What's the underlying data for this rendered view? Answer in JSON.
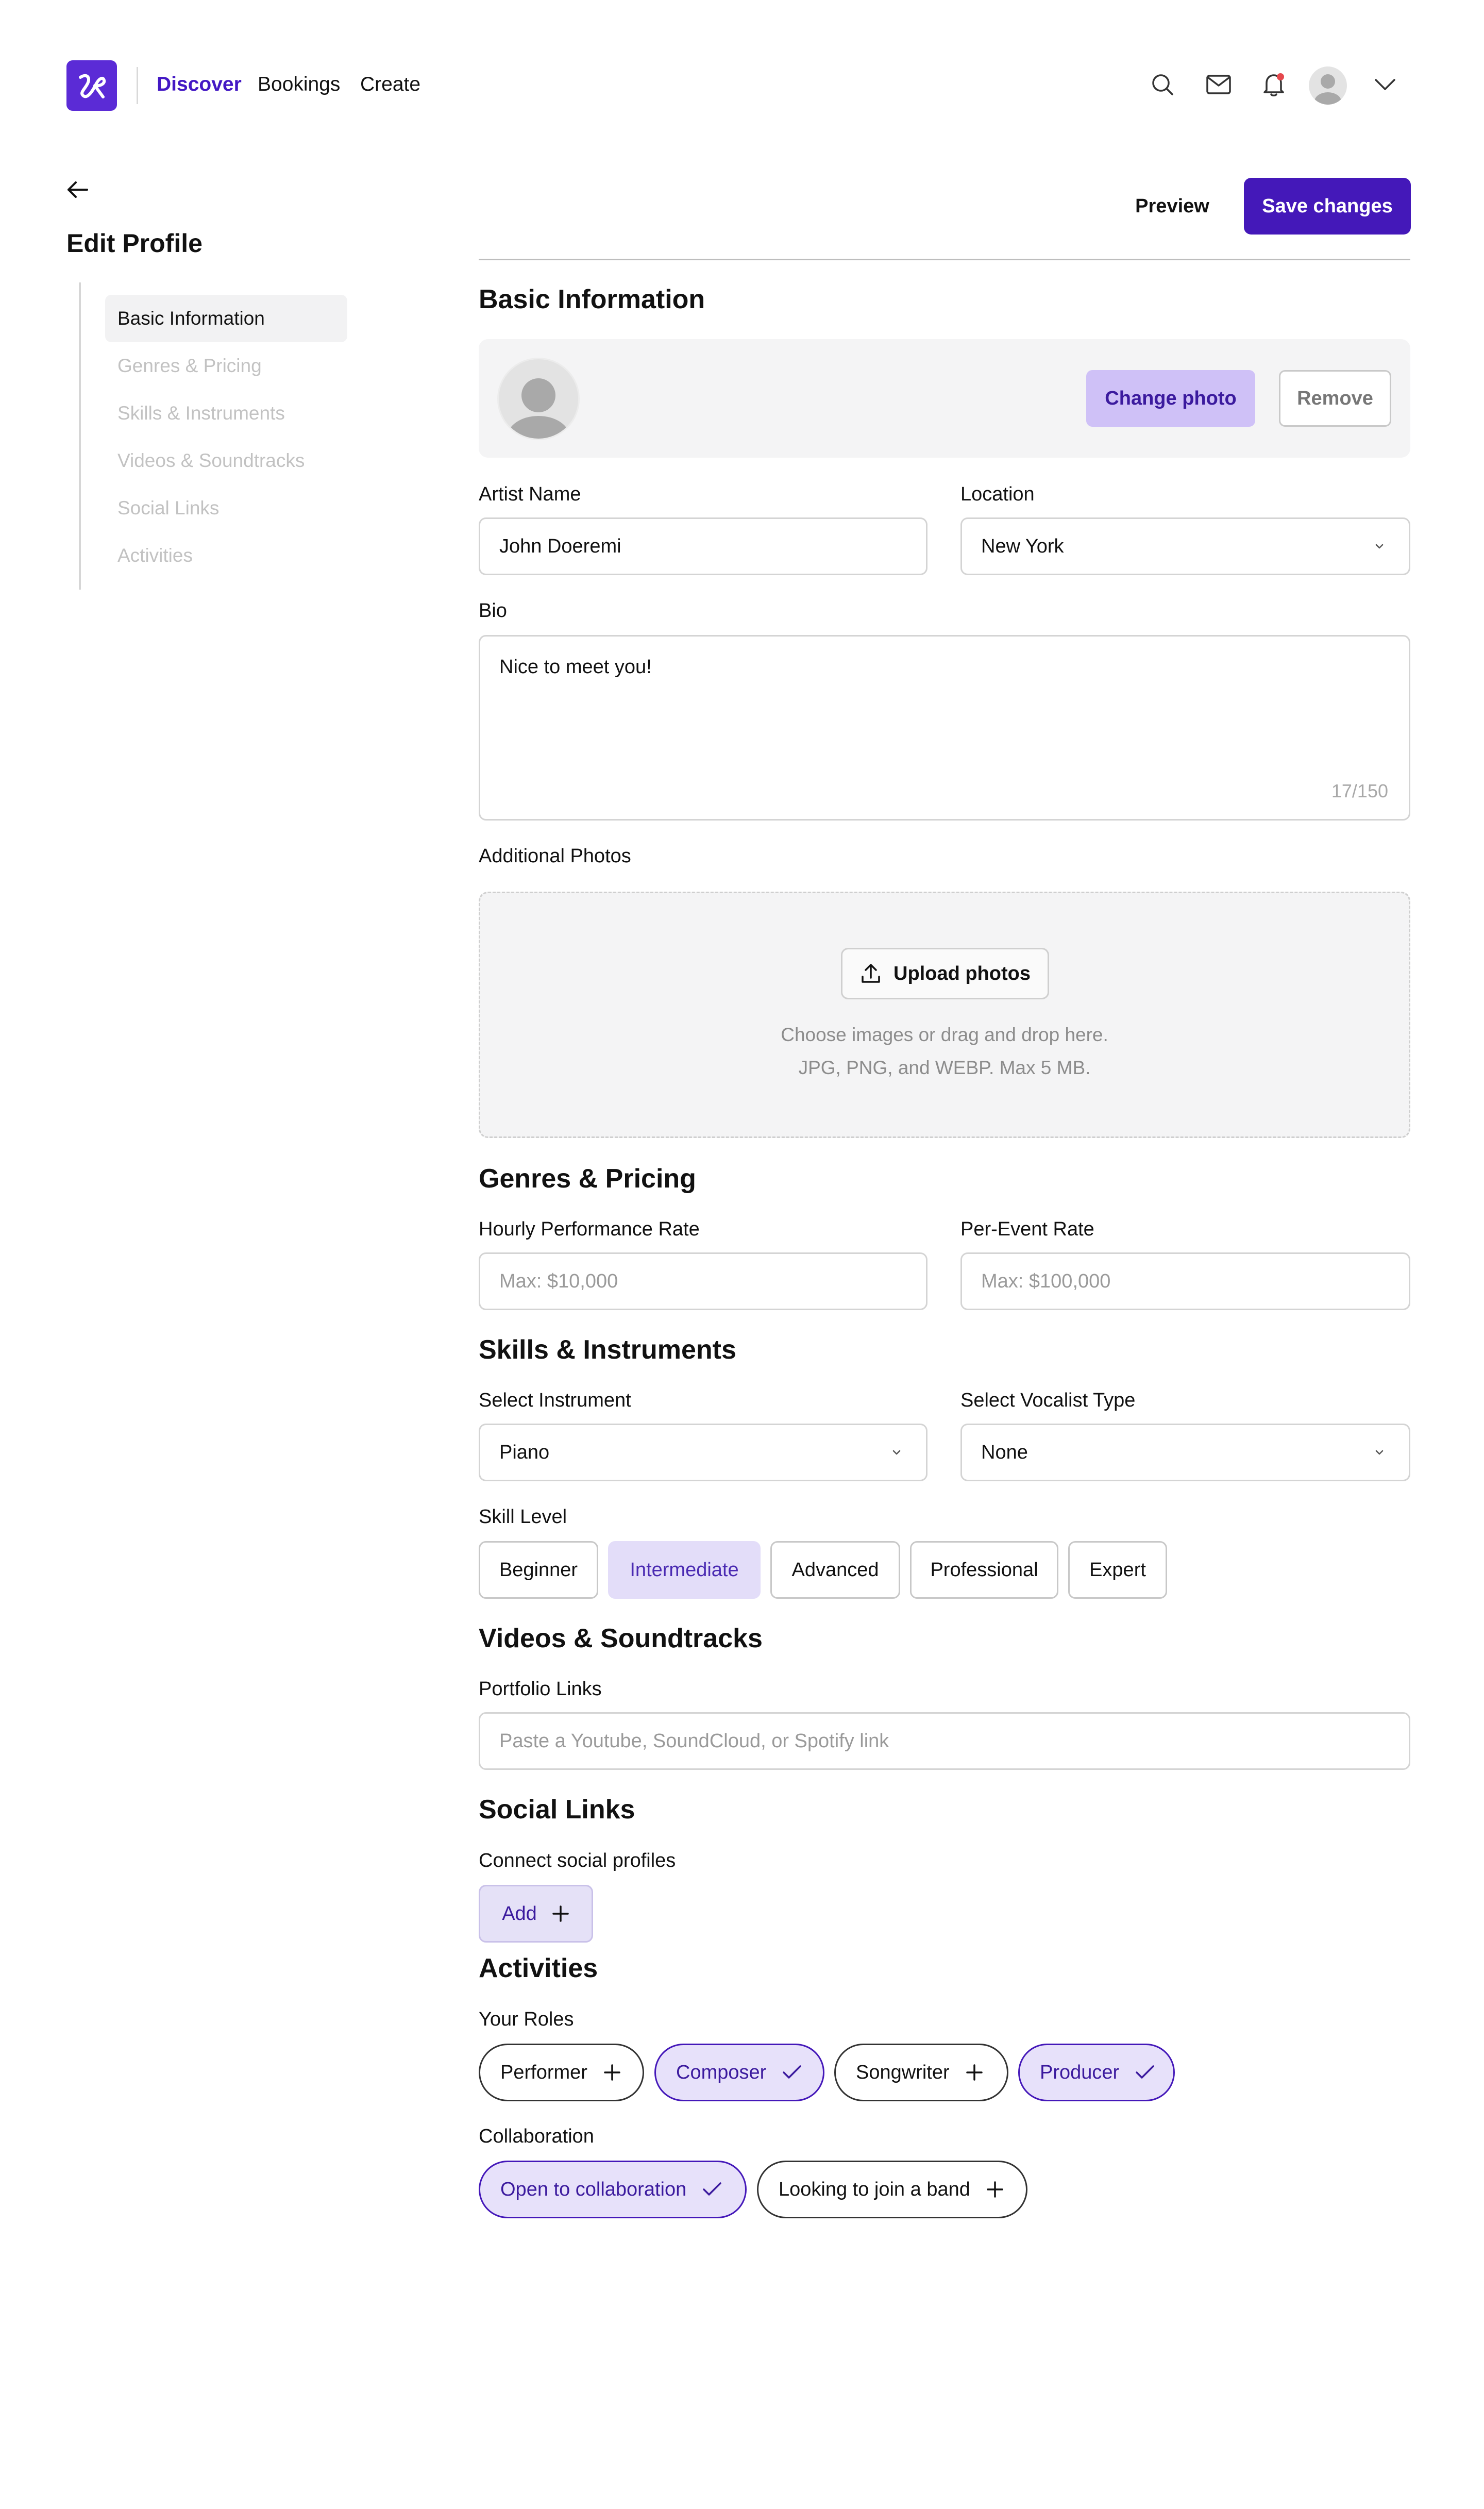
{
  "nav": {
    "links": [
      "Discover",
      "Bookings",
      "Create"
    ],
    "active": "Discover",
    "icons": [
      "search-icon",
      "mail-icon",
      "bell-icon",
      "avatar",
      "chevron-down-icon"
    ],
    "accent": "#4318c4",
    "notification_dot_color": "#e5484d"
  },
  "sidebar": {
    "title": "Edit Profile",
    "items": [
      {
        "label": "Basic Information",
        "active": true
      },
      {
        "label": "Genres & Pricing"
      },
      {
        "label": "Skills & Instruments"
      },
      {
        "label": "Videos & Soundtracks"
      },
      {
        "label": "Social Links"
      },
      {
        "label": "Activities"
      }
    ]
  },
  "actions": {
    "preview": "Preview",
    "save": "Save changes",
    "save_color": "#4418b9"
  },
  "basic": {
    "title": "Basic Information",
    "change_photo": "Change photo",
    "remove": "Remove",
    "artist_name_label": "Artist Name",
    "artist_name_value": "John Doeremi",
    "location_label": "Location",
    "location_value": "New York",
    "bio_label": "Bio",
    "bio_value": "Nice to meet you!",
    "bio_count": "17/150",
    "photos_label": "Additional Photos",
    "upload": "Upload photos",
    "hint_1": "Choose images or drag and drop here.",
    "hint_2": "JPG, PNG, and WEBP. Max 5 MB."
  },
  "pricing": {
    "title": "Genres & Pricing",
    "hourly_label": "Hourly Performance Rate",
    "hourly_placeholder": "Max: $10,000",
    "event_label": "Per-Event Rate",
    "event_placeholder": "Max: $100,000"
  },
  "skills": {
    "title": "Skills & Instruments",
    "instrument_label": "Select Instrument",
    "instrument_value": "Piano",
    "vocalist_label": "Select Vocalist Type",
    "vocalist_value": "None",
    "level_label": "Skill Level",
    "levels": [
      "Beginner",
      "Intermediate",
      "Advanced",
      "Professional",
      "Expert"
    ],
    "selected_level": "Intermediate"
  },
  "videos": {
    "title": "Videos & Soundtracks",
    "portfolio_label": "Portfolio Links",
    "portfolio_placeholder": "Paste a Youtube, SoundCloud, or Spotify link"
  },
  "social": {
    "title": "Social Links",
    "connect_label": "Connect social profiles",
    "add": "Add"
  },
  "activities": {
    "title": "Activities",
    "roles_label": "Your Roles",
    "roles": [
      {
        "label": "Performer",
        "selected": false
      },
      {
        "label": "Composer",
        "selected": true
      },
      {
        "label": "Songwriter",
        "selected": false
      },
      {
        "label": "Producer",
        "selected": true
      }
    ],
    "collab_label": "Collaboration",
    "collab": [
      {
        "label": "Open to collaboration",
        "selected": true
      },
      {
        "label": "Looking to join a band",
        "selected": false
      }
    ]
  }
}
